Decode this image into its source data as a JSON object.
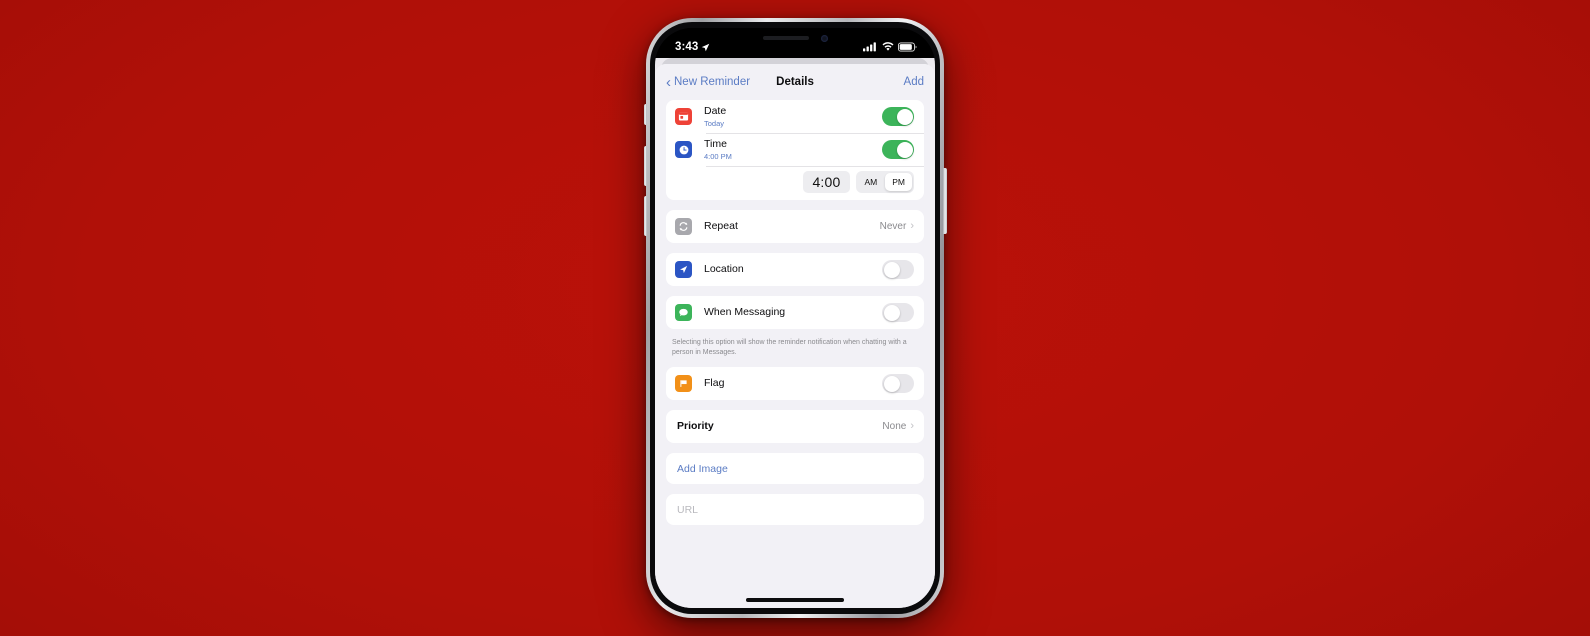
{
  "background": {
    "color": "#b01008"
  },
  "status_bar": {
    "time": "3:43",
    "location_icon": "location-arrow-icon",
    "cellular_icon": "cellular-bars-icon",
    "wifi_icon": "wifi-icon",
    "battery_icon": "battery-icon"
  },
  "nav_bar": {
    "back_label": "New Reminder",
    "back_icon": "chevron-left-icon",
    "title": "Details",
    "add_label": "Add"
  },
  "sections": {
    "datetime": {
      "date": {
        "icon": "calendar-icon",
        "icon_color": "#ee4237",
        "title": "Date",
        "subtitle": "Today",
        "toggle": "on"
      },
      "time": {
        "icon": "clock-icon",
        "icon_color": "#2b55c4",
        "title": "Time",
        "subtitle": "4:00 PM",
        "toggle": "on"
      },
      "picker": {
        "value": "4:00",
        "am_label": "AM",
        "pm_label": "PM",
        "selected": "PM"
      }
    },
    "repeat": {
      "icon": "repeat-icon",
      "icon_color": "#a8a8ad",
      "title": "Repeat",
      "value": "Never",
      "disclosure": "chevron-right-icon"
    },
    "location": {
      "icon": "navigation-arrow-icon",
      "icon_color": "#2b55c4",
      "title": "Location",
      "toggle": "off"
    },
    "messaging": {
      "icon": "message-bubble-icon",
      "icon_color": "#3cb45a",
      "title": "When Messaging",
      "toggle": "off",
      "footnote": "Selecting this option will show the reminder notification when chatting with a person in Messages."
    },
    "flag": {
      "icon": "flag-icon",
      "icon_color": "#f29018",
      "title": "Flag",
      "toggle": "off"
    },
    "priority": {
      "title": "Priority",
      "value": "None",
      "disclosure": "chevron-right-icon"
    },
    "add_image": {
      "label": "Add Image"
    },
    "url": {
      "placeholder": "URL",
      "value": ""
    }
  },
  "colors": {
    "accent_blue": "#5b7cc4",
    "toggle_on_green": "#3cb45a",
    "toggle_off_gray": "#e7e6ea",
    "sheet_bg": "#f2f1f6"
  }
}
